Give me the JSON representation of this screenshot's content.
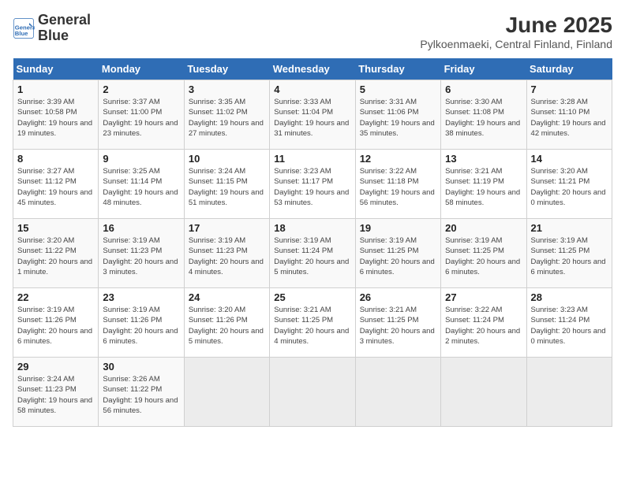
{
  "logo": {
    "line1": "General",
    "line2": "Blue"
  },
  "title": "June 2025",
  "subtitle": "Pylkoenmaeki, Central Finland, Finland",
  "days_of_week": [
    "Sunday",
    "Monday",
    "Tuesday",
    "Wednesday",
    "Thursday",
    "Friday",
    "Saturday"
  ],
  "weeks": [
    [
      {
        "day": "1",
        "sunrise": "3:39 AM",
        "sunset": "10:58 PM",
        "daylight": "19 hours and 19 minutes."
      },
      {
        "day": "2",
        "sunrise": "3:37 AM",
        "sunset": "11:00 PM",
        "daylight": "19 hours and 23 minutes."
      },
      {
        "day": "3",
        "sunrise": "3:35 AM",
        "sunset": "11:02 PM",
        "daylight": "19 hours and 27 minutes."
      },
      {
        "day": "4",
        "sunrise": "3:33 AM",
        "sunset": "11:04 PM",
        "daylight": "19 hours and 31 minutes."
      },
      {
        "day": "5",
        "sunrise": "3:31 AM",
        "sunset": "11:06 PM",
        "daylight": "19 hours and 35 minutes."
      },
      {
        "day": "6",
        "sunrise": "3:30 AM",
        "sunset": "11:08 PM",
        "daylight": "19 hours and 38 minutes."
      },
      {
        "day": "7",
        "sunrise": "3:28 AM",
        "sunset": "11:10 PM",
        "daylight": "19 hours and 42 minutes."
      }
    ],
    [
      {
        "day": "8",
        "sunrise": "3:27 AM",
        "sunset": "11:12 PM",
        "daylight": "19 hours and 45 minutes."
      },
      {
        "day": "9",
        "sunrise": "3:25 AM",
        "sunset": "11:14 PM",
        "daylight": "19 hours and 48 minutes."
      },
      {
        "day": "10",
        "sunrise": "3:24 AM",
        "sunset": "11:15 PM",
        "daylight": "19 hours and 51 minutes."
      },
      {
        "day": "11",
        "sunrise": "3:23 AM",
        "sunset": "11:17 PM",
        "daylight": "19 hours and 53 minutes."
      },
      {
        "day": "12",
        "sunrise": "3:22 AM",
        "sunset": "11:18 PM",
        "daylight": "19 hours and 56 minutes."
      },
      {
        "day": "13",
        "sunrise": "3:21 AM",
        "sunset": "11:19 PM",
        "daylight": "19 hours and 58 minutes."
      },
      {
        "day": "14",
        "sunrise": "3:20 AM",
        "sunset": "11:21 PM",
        "daylight": "20 hours and 0 minutes."
      }
    ],
    [
      {
        "day": "15",
        "sunrise": "3:20 AM",
        "sunset": "11:22 PM",
        "daylight": "20 hours and 1 minute."
      },
      {
        "day": "16",
        "sunrise": "3:19 AM",
        "sunset": "11:23 PM",
        "daylight": "20 hours and 3 minutes."
      },
      {
        "day": "17",
        "sunrise": "3:19 AM",
        "sunset": "11:23 PM",
        "daylight": "20 hours and 4 minutes."
      },
      {
        "day": "18",
        "sunrise": "3:19 AM",
        "sunset": "11:24 PM",
        "daylight": "20 hours and 5 minutes."
      },
      {
        "day": "19",
        "sunrise": "3:19 AM",
        "sunset": "11:25 PM",
        "daylight": "20 hours and 6 minutes."
      },
      {
        "day": "20",
        "sunrise": "3:19 AM",
        "sunset": "11:25 PM",
        "daylight": "20 hours and 6 minutes."
      },
      {
        "day": "21",
        "sunrise": "3:19 AM",
        "sunset": "11:25 PM",
        "daylight": "20 hours and 6 minutes."
      }
    ],
    [
      {
        "day": "22",
        "sunrise": "3:19 AM",
        "sunset": "11:26 PM",
        "daylight": "20 hours and 6 minutes."
      },
      {
        "day": "23",
        "sunrise": "3:19 AM",
        "sunset": "11:26 PM",
        "daylight": "20 hours and 6 minutes."
      },
      {
        "day": "24",
        "sunrise": "3:20 AM",
        "sunset": "11:26 PM",
        "daylight": "20 hours and 5 minutes."
      },
      {
        "day": "25",
        "sunrise": "3:21 AM",
        "sunset": "11:25 PM",
        "daylight": "20 hours and 4 minutes."
      },
      {
        "day": "26",
        "sunrise": "3:21 AM",
        "sunset": "11:25 PM",
        "daylight": "20 hours and 3 minutes."
      },
      {
        "day": "27",
        "sunrise": "3:22 AM",
        "sunset": "11:24 PM",
        "daylight": "20 hours and 2 minutes."
      },
      {
        "day": "28",
        "sunrise": "3:23 AM",
        "sunset": "11:24 PM",
        "daylight": "20 hours and 0 minutes."
      }
    ],
    [
      {
        "day": "29",
        "sunrise": "3:24 AM",
        "sunset": "11:23 PM",
        "daylight": "19 hours and 58 minutes."
      },
      {
        "day": "30",
        "sunrise": "3:26 AM",
        "sunset": "11:22 PM",
        "daylight": "19 hours and 56 minutes."
      },
      null,
      null,
      null,
      null,
      null
    ]
  ]
}
